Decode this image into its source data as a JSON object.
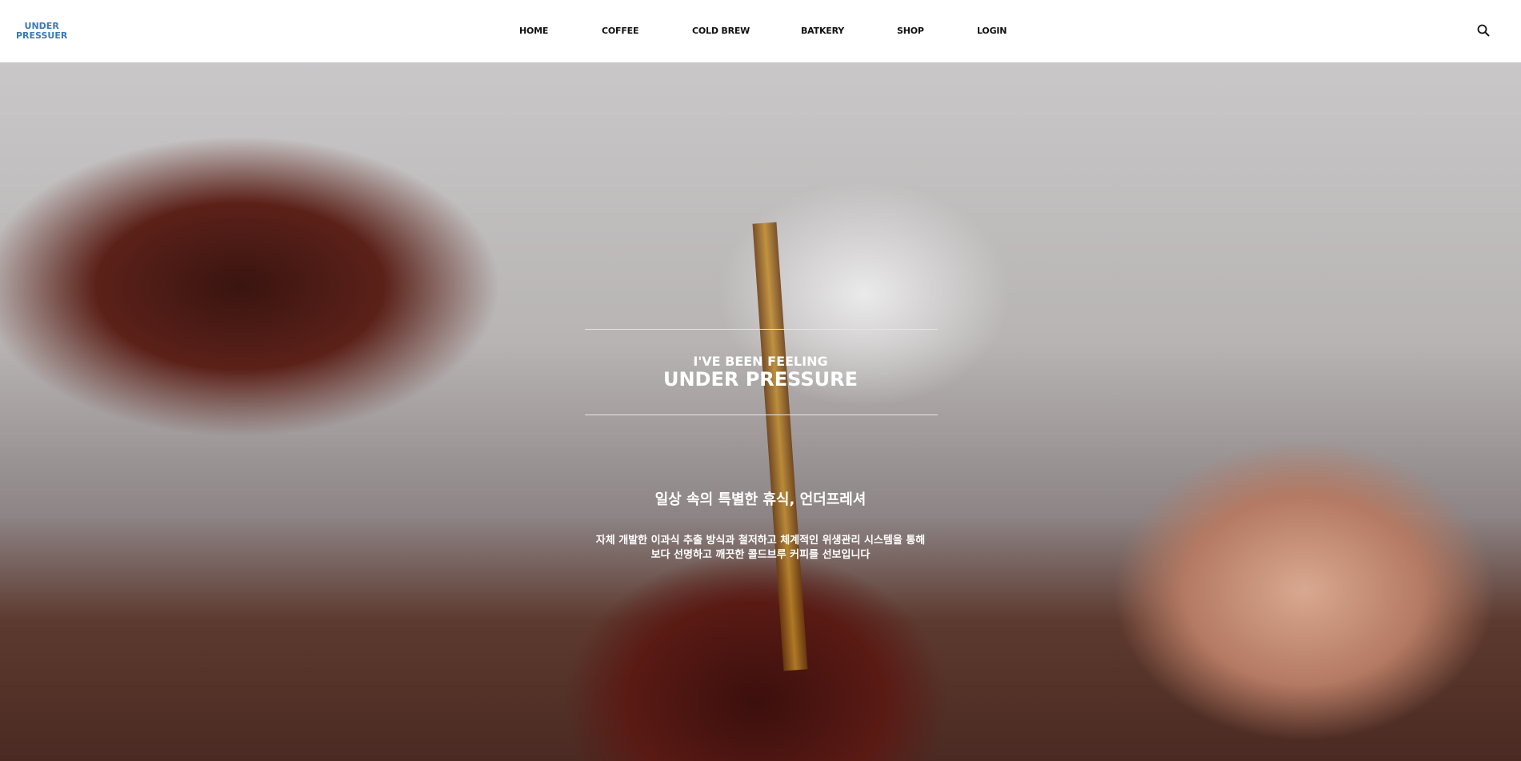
{
  "header": {
    "logo_line1": "UNDER",
    "logo_line2": "PRESSUER",
    "nav": [
      "HOME",
      "COFFEE",
      "COLD BREW",
      "BATKERY",
      "SHOP",
      "LOGIN"
    ],
    "search_icon": "search-icon"
  },
  "hero": {
    "kicker": "I'VE BEEN FEELING",
    "title": "UNDER PRESSURE",
    "subtitle": "일상 속의 특별한 휴식, 언더프레셔",
    "desc_line1": "자체 개발한 이과식 추출 방식과 철저하고 체계적인 위생관리 시스템을 통해",
    "desc_line2": "보다 선명하고 깨끗한 콜드브루 커피를 선보입니다"
  },
  "colors": {
    "logo": "#3a7ab5"
  }
}
